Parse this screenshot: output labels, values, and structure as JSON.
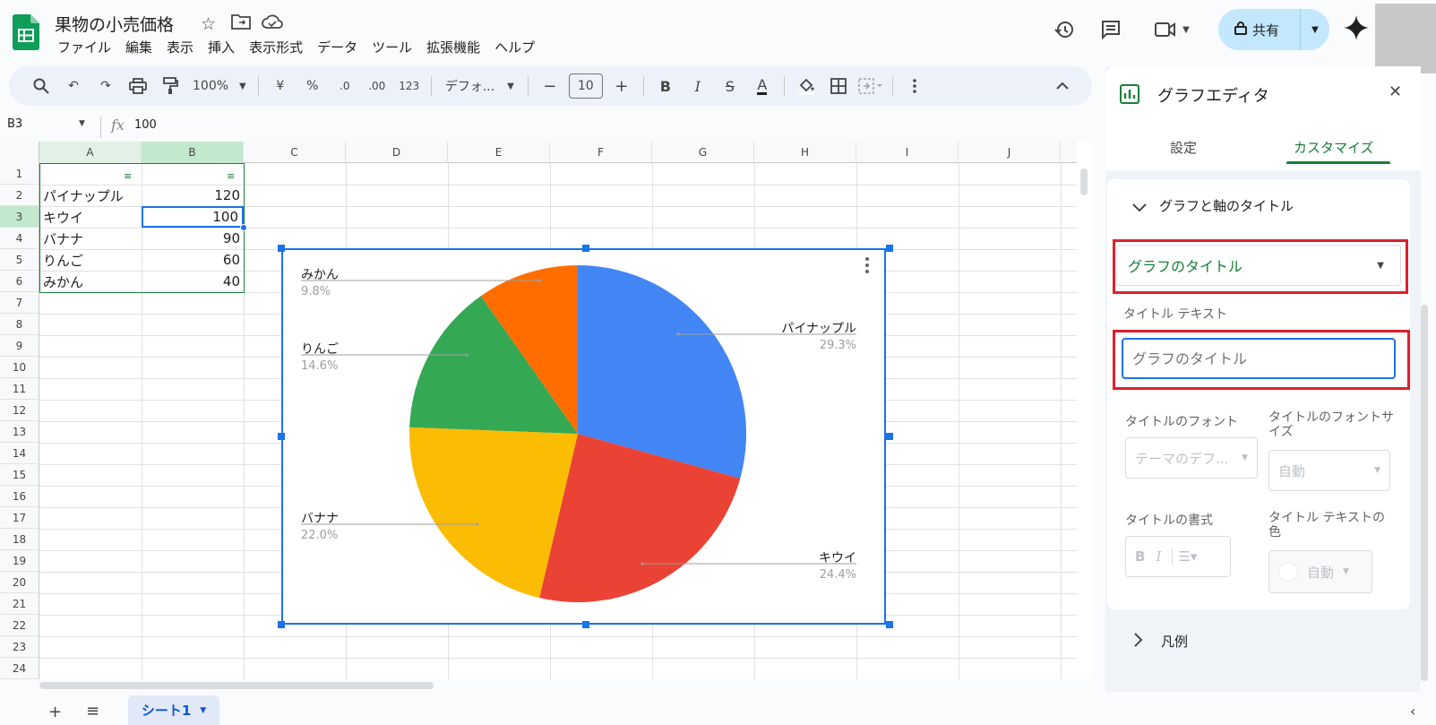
{
  "header": {
    "doc_title": "果物の小売価格",
    "menu": [
      "ファイル",
      "編集",
      "表示",
      "挿入",
      "表示形式",
      "データ",
      "ツール",
      "拡張機能",
      "ヘルプ"
    ],
    "share_label": "共有"
  },
  "toolbar": {
    "zoom": "100%",
    "currency": "¥",
    "percent": "%",
    "dec_decrease": ".0",
    "dec_increase": ".00",
    "format_123": "123",
    "font": "デフォ...",
    "font_size": "10",
    "bold": "B",
    "italic": "I"
  },
  "formula_bar": {
    "cell_ref": "B3",
    "fx": "fx",
    "value": "100"
  },
  "grid": {
    "columns": [
      "A",
      "B",
      "C",
      "D",
      "E",
      "F",
      "G",
      "H",
      "I",
      "J"
    ],
    "rows": [
      "1",
      "2",
      "3",
      "4",
      "5",
      "6",
      "7",
      "8",
      "9",
      "10",
      "11",
      "12",
      "13",
      "14",
      "15",
      "16",
      "17",
      "18",
      "19",
      "20",
      "21",
      "22",
      "23",
      "24"
    ],
    "data": [
      {
        "name": "パイナップル",
        "value": "120"
      },
      {
        "name": "キウイ",
        "value": "100"
      },
      {
        "name": "バナナ",
        "value": "90"
      },
      {
        "name": "りんご",
        "value": "60"
      },
      {
        "name": "みかん",
        "value": "40"
      }
    ]
  },
  "chart_data": {
    "type": "pie",
    "categories": [
      "パイナップル",
      "キウイ",
      "バナナ",
      "りんご",
      "みかん"
    ],
    "values": [
      120,
      100,
      90,
      60,
      40
    ],
    "percent_labels": [
      "29.3%",
      "24.4%",
      "22.0%",
      "14.6%",
      "9.8%"
    ],
    "colors": [
      "#4285f4",
      "#ea4335",
      "#fbbc04",
      "#34a853",
      "#ff6d01"
    ],
    "title": ""
  },
  "editor": {
    "title": "グラフエディタ",
    "tabs": [
      "設定",
      "カスタマイズ"
    ],
    "active_tab": "カスタマイズ",
    "section_title": "グラフと軸のタイトル",
    "dropdown_value": "グラフのタイトル",
    "title_text_label": "タイトル テキスト",
    "title_input_placeholder": "グラフのタイトル",
    "font_label": "タイトルのフォント",
    "font_value": "テーマのデフ...",
    "font_size_label": "タイトルのフォントサイズ",
    "font_size_value": "自動",
    "format_label": "タイトルの書式",
    "color_label": "タイトル テキストの色",
    "color_value": "自動",
    "legend_section": "凡例"
  },
  "sheets": {
    "active": "シート1"
  },
  "colors": {
    "accent": "#1a73e8",
    "green": "#188038",
    "highlight": "#e01e2b"
  }
}
